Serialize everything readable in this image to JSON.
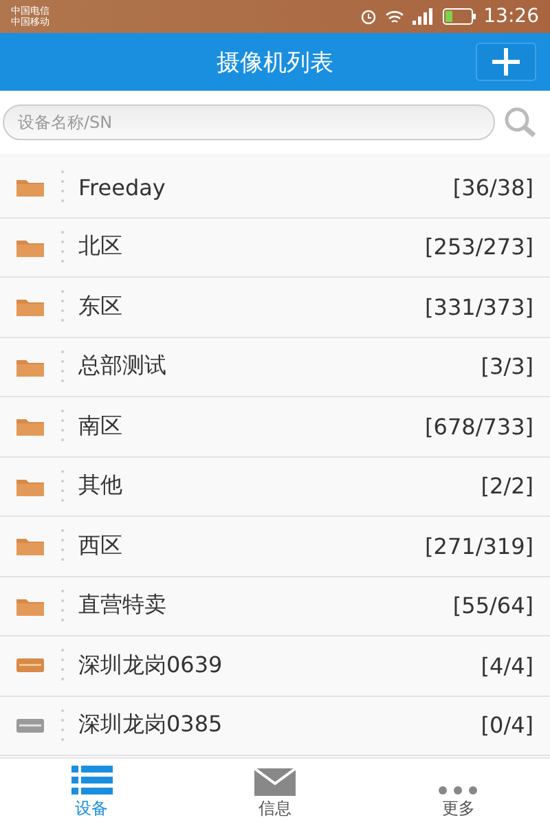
{
  "status_bar": {
    "carriers": [
      "中国电信",
      "中国移动"
    ],
    "time": "13:26"
  },
  "header": {
    "title": "摄像机列表"
  },
  "search": {
    "placeholder": "设备名称/SN"
  },
  "items": [
    {
      "kind": "folder",
      "name": "Freeday",
      "count": "[36/38]"
    },
    {
      "kind": "folder",
      "name": "北区",
      "count": "[253/273]"
    },
    {
      "kind": "folder",
      "name": "东区",
      "count": "[331/373]"
    },
    {
      "kind": "folder",
      "name": "总部测试",
      "count": "[3/3]"
    },
    {
      "kind": "folder",
      "name": "南区",
      "count": "[678/733]"
    },
    {
      "kind": "folder",
      "name": "其他",
      "count": "[2/2]"
    },
    {
      "kind": "folder",
      "name": "西区",
      "count": "[271/319]"
    },
    {
      "kind": "folder",
      "name": "直营特卖",
      "count": "[55/64]"
    },
    {
      "kind": "device",
      "online": true,
      "name": "深圳龙岗0639",
      "count": "[4/4]"
    },
    {
      "kind": "device",
      "online": false,
      "name": "深圳龙岗0385",
      "count": "[0/4]"
    }
  ],
  "tabs": [
    {
      "kind": "list",
      "label": "设备",
      "selected": true
    },
    {
      "kind": "mail",
      "label": "信息",
      "selected": false
    },
    {
      "kind": "more",
      "label": "更多",
      "selected": false
    }
  ]
}
